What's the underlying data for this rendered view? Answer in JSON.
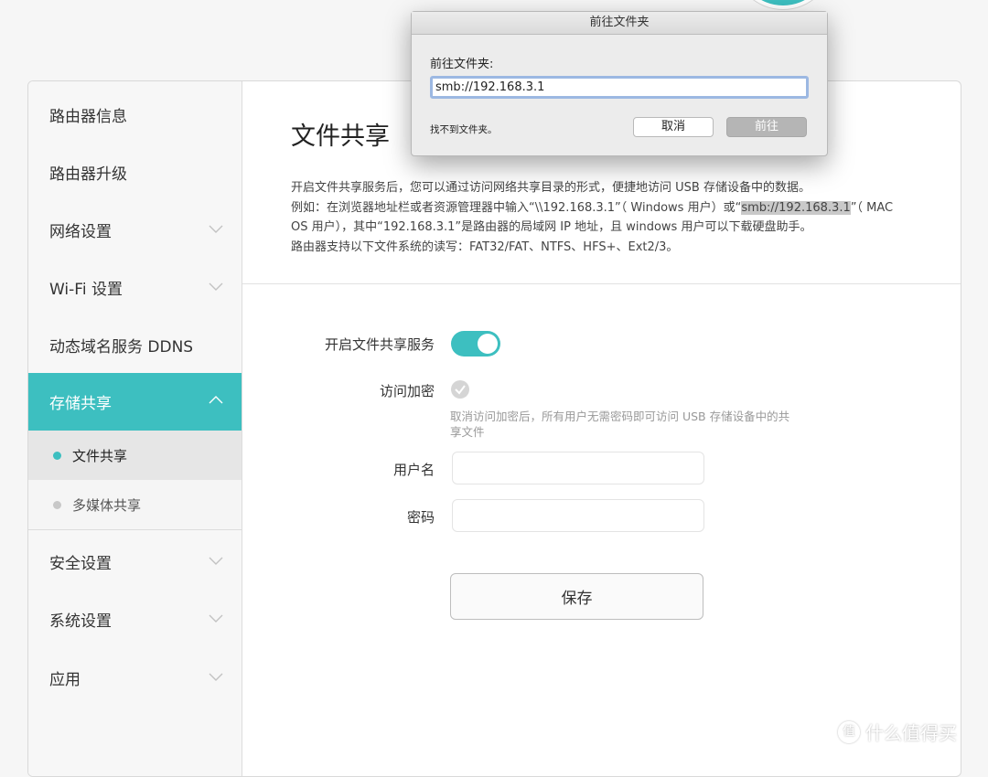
{
  "dialog": {
    "title": "前往文件夹",
    "label": "前往文件夹:",
    "input_value": "smb://192.168.3.1",
    "error": "找不到文件夹。",
    "cancel": "取消",
    "go": "前往"
  },
  "sidebar": {
    "items": [
      {
        "label": "路由器信息",
        "chevron": false
      },
      {
        "label": "路由器升级",
        "chevron": false
      },
      {
        "label": "网络设置",
        "chevron": true
      },
      {
        "label": "Wi-Fi 设置",
        "chevron": true
      },
      {
        "label": "动态域名服务 DDNS",
        "chevron": false
      },
      {
        "label": "存储共享",
        "chevron": true,
        "active": true
      },
      {
        "label": "安全设置",
        "chevron": true
      },
      {
        "label": "系统设置",
        "chevron": true
      },
      {
        "label": "应用",
        "chevron": true
      }
    ],
    "sub_items": [
      {
        "label": "文件共享",
        "active": true
      },
      {
        "label": "多媒体共享",
        "active": false
      }
    ]
  },
  "main": {
    "title": "文件共享",
    "desc_line1": "开启文件共享服务后，您可以通过访问网络共享目录的形式，便捷地访问 USB 存储设备中的数据。",
    "desc_line2_a": "例如：在浏览器地址栏或者资源管理器中输入“\\\\192.168.3.1”（ Windows 用户）或“",
    "desc_line2_hl": "smb://192.168.3.1",
    "desc_line2_b": "”（ MAC",
    "desc_line3": "OS 用户），其中“192.168.3.1”是路由器的局域网 IP 地址，且 windows 用户可以下载硬盘助手。",
    "desc_line4": "路由器支持以下文件系统的读写：FAT32/FAT、NTFS、HFS+、Ext2/3。",
    "service_label": "开启文件共享服务",
    "service_on": true,
    "encrypt_label": "访问加密",
    "encrypt_checked": false,
    "hint": "取消访问加密后，所有用户无需密码即可访问 USB 存储设备中的共享文件",
    "username_label": "用户名",
    "username_value": "",
    "password_label": "密码",
    "password_value": "",
    "save": "保存"
  },
  "watermark": {
    "text": "什么值得买",
    "icon": "值"
  },
  "colors": {
    "accent": "#3dbfc0",
    "sidebar_bg": "#f7f7f7",
    "page_bg": "#f6f6f6"
  }
}
